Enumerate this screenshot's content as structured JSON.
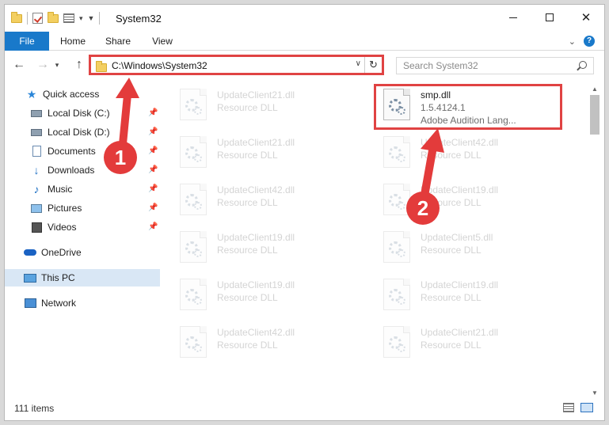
{
  "window": {
    "title": "System32",
    "controls": {
      "minimize": "minimize",
      "maximize": "maximize",
      "close": "✕"
    }
  },
  "ribbon": {
    "tabs": [
      {
        "label": "File"
      },
      {
        "label": "Home"
      },
      {
        "label": "Share"
      },
      {
        "label": "View"
      }
    ]
  },
  "nav": {
    "back": "←",
    "forward": "→",
    "up": "↑",
    "address": "C:\\Windows\\System32",
    "refresh": "↻",
    "search_placeholder": "Search System32"
  },
  "sidebar": {
    "items": [
      {
        "label": "Quick access",
        "icon": "star-icon"
      },
      {
        "label": "Local Disk (C:)",
        "icon": "drive-icon",
        "pinned": true
      },
      {
        "label": "Local Disk (D:)",
        "icon": "drive-icon",
        "pinned": true
      },
      {
        "label": "Documents",
        "icon": "documents-icon",
        "pinned": true
      },
      {
        "label": "Downloads",
        "icon": "download-icon",
        "pinned": true
      },
      {
        "label": "Music",
        "icon": "music-icon",
        "pinned": true
      },
      {
        "label": "Pictures",
        "icon": "pictures-icon",
        "pinned": true
      },
      {
        "label": "Videos",
        "icon": "videos-icon",
        "pinned": true
      },
      {
        "label": "OneDrive",
        "icon": "cloud-icon"
      },
      {
        "label": "This PC",
        "icon": "computer-icon",
        "selected": true
      },
      {
        "label": "Network",
        "icon": "network-icon"
      }
    ]
  },
  "files": [
    {
      "name": "UpdateClient21.dll",
      "type": "Resource DLL",
      "faded": true
    },
    {
      "name": "smp.dll",
      "version": "1.5.4124.1",
      "description": "Adobe Audition Lang...",
      "faded": false,
      "highlighted": true
    },
    {
      "name": "UpdateClient21.dll",
      "type": "Resource DLL",
      "faded": true
    },
    {
      "name": "UpdateClient42.dll",
      "type": "Resource DLL",
      "faded": true
    },
    {
      "name": "UpdateClient42.dll",
      "type": "Resource DLL",
      "faded": true
    },
    {
      "name": "UpdateClient19.dll",
      "type": "Resource DLL",
      "faded": true
    },
    {
      "name": "UpdateClient19.dll",
      "type": "Resource DLL",
      "faded": true
    },
    {
      "name": "UpdateClient5.dll",
      "type": "Resource DLL",
      "faded": true
    },
    {
      "name": "UpdateClient19.dll",
      "type": "Resource DLL",
      "faded": true
    },
    {
      "name": "UpdateClient19.dll",
      "type": "Resource DLL",
      "faded": true
    },
    {
      "name": "UpdateClient42.dll",
      "type": "Resource DLL",
      "faded": true
    },
    {
      "name": "UpdateClient21.dll",
      "type": "Resource DLL",
      "faded": true
    }
  ],
  "status": {
    "item_count": "111 items"
  },
  "annotations": {
    "step1": "1",
    "step2": "2",
    "color": "#e33b3b"
  }
}
